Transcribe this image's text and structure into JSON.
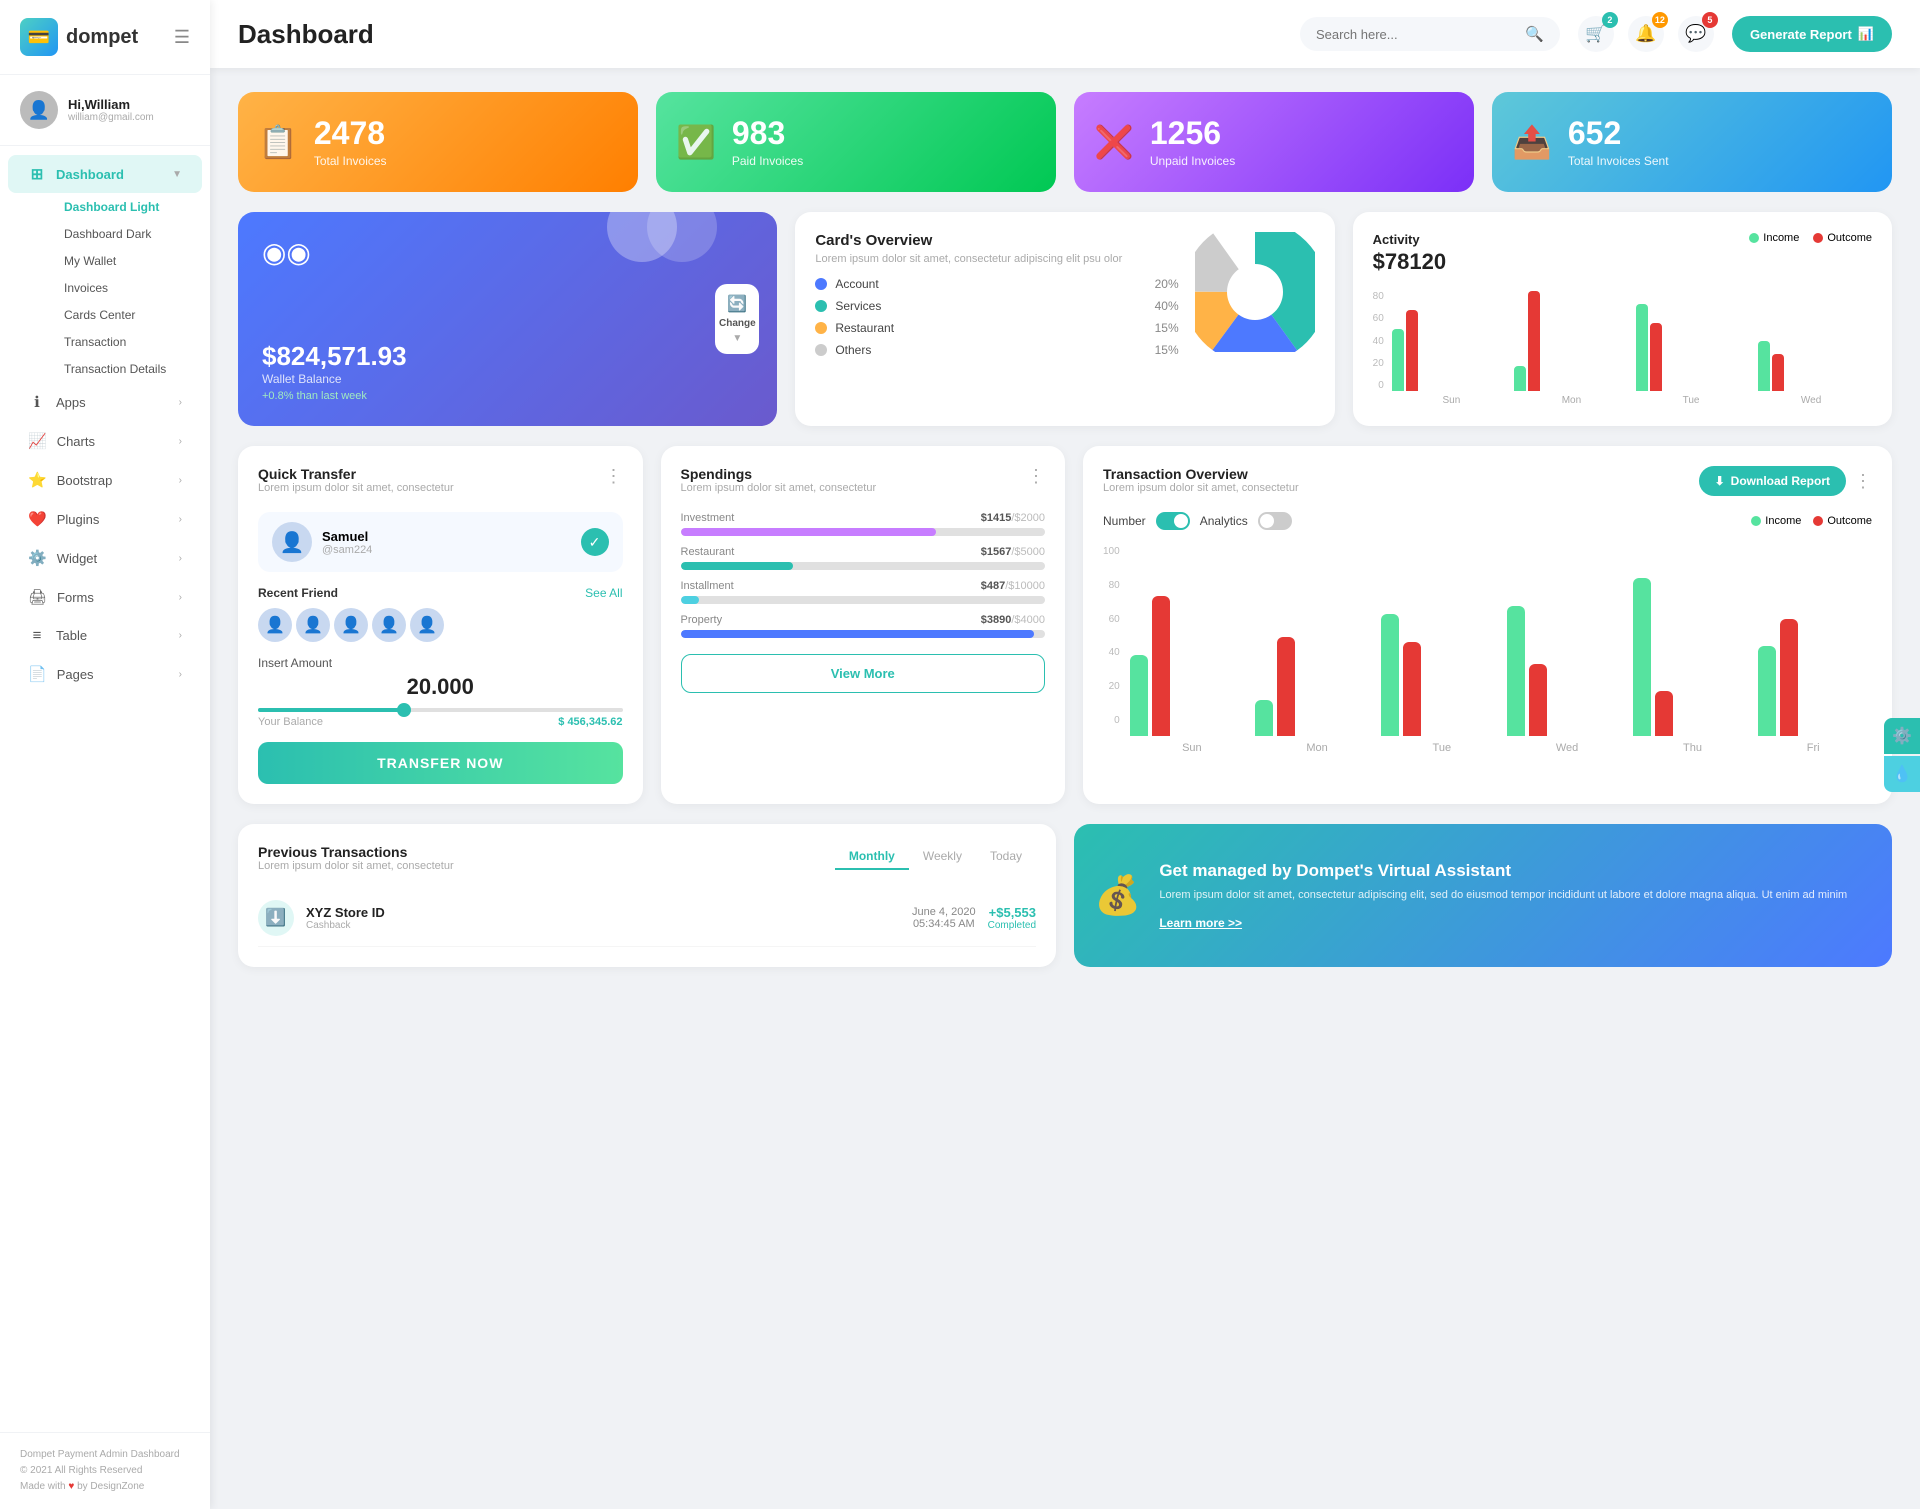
{
  "app": {
    "logo_text": "dompet",
    "logo_icon": "💳"
  },
  "user": {
    "greeting": "Hi,",
    "name": "William",
    "email": "william@gmail.com",
    "avatar_icon": "👤"
  },
  "header": {
    "title": "Dashboard",
    "search_placeholder": "Search here...",
    "generate_btn": "Generate Report",
    "badges": {
      "cart": "2",
      "bell": "12",
      "chat": "5"
    }
  },
  "stats": [
    {
      "number": "2478",
      "label": "Total Invoices",
      "icon": "📋",
      "color": "orange"
    },
    {
      "number": "983",
      "label": "Paid Invoices",
      "icon": "✅",
      "color": "green"
    },
    {
      "number": "1256",
      "label": "Unpaid Invoices",
      "icon": "❌",
      "color": "purple"
    },
    {
      "number": "652",
      "label": "Total Invoices Sent",
      "icon": "📤",
      "color": "teal"
    }
  ],
  "wallet": {
    "balance": "$824,571.93",
    "label": "Wallet Balance",
    "change": "+0.8% than last week",
    "change_btn": "Change"
  },
  "card_overview": {
    "title": "Card's Overview",
    "desc": "Lorem ipsum dolor sit amet, consectetur adipiscing elit psu olor",
    "legend": [
      {
        "label": "Account",
        "pct": "20%",
        "color": "#4d79ff"
      },
      {
        "label": "Services",
        "pct": "40%",
        "color": "#2bbfb0"
      },
      {
        "label": "Restaurant",
        "pct": "15%",
        "color": "#ffb347"
      },
      {
        "label": "Others",
        "pct": "15%",
        "color": "#ccc"
      }
    ]
  },
  "activity": {
    "title": "Activity",
    "amount": "$78120",
    "income_label": "Income",
    "outcome_label": "Outcome",
    "income_color": "#56e39f",
    "outcome_color": "#e53935",
    "bars": [
      {
        "day": "Sun",
        "income": 50,
        "outcome": 65
      },
      {
        "day": "Mon",
        "income": 20,
        "outcome": 80
      },
      {
        "day": "Tue",
        "income": 70,
        "outcome": 55
      },
      {
        "day": "Wed",
        "income": 40,
        "outcome": 30
      }
    ],
    "y_labels": [
      "80",
      "60",
      "40",
      "20",
      "0"
    ]
  },
  "quick_transfer": {
    "title": "Quick Transfer",
    "desc": "Lorem ipsum dolor sit amet, consectetur",
    "user_name": "Samuel",
    "user_handle": "@sam224",
    "recent_label": "Recent Friend",
    "see_all": "See All",
    "insert_label": "Insert Amount",
    "amount": "20.000",
    "balance_label": "Your Balance",
    "balance_value": "$ 456,345.62",
    "btn": "TRANSFER NOW"
  },
  "spendings": {
    "title": "Spendings",
    "desc": "Lorem ipsum dolor sit amet, consectetur",
    "items": [
      {
        "label": "Investment",
        "amount": "$1415",
        "max": "/$2000",
        "pct": 70,
        "color": "#c77dff"
      },
      {
        "label": "Restaurant",
        "amount": "$1567",
        "max": "/$5000",
        "pct": 31,
        "color": "#2bbfb0"
      },
      {
        "label": "Installment",
        "amount": "$487",
        "max": "/$10000",
        "pct": 5,
        "color": "#4dd0e1"
      },
      {
        "label": "Property",
        "amount": "$3890",
        "max": "/$4000",
        "pct": 97,
        "color": "#4d79ff"
      }
    ],
    "btn": "View More"
  },
  "transaction_overview": {
    "title": "Transaction Overview",
    "desc": "Lorem ipsum dolor sit amet, consectetur",
    "download_btn": "Download Report",
    "number_label": "Number",
    "analytics_label": "Analytics",
    "income_label": "Income",
    "outcome_label": "Outcome",
    "income_color": "#56e39f",
    "outcome_color": "#e53935",
    "bars": [
      {
        "day": "Sun",
        "income": 45,
        "outcome": 78
      },
      {
        "day": "Mon",
        "income": 20,
        "outcome": 55
      },
      {
        "day": "Tue",
        "income": 68,
        "outcome": 52
      },
      {
        "day": "Wed",
        "income": 72,
        "outcome": 40
      },
      {
        "day": "Thu",
        "income": 88,
        "outcome": 25
      },
      {
        "day": "Fri",
        "income": 50,
        "outcome": 65
      }
    ],
    "y_labels": [
      "100",
      "80",
      "60",
      "40",
      "20",
      "0"
    ]
  },
  "prev_transactions": {
    "title": "Previous Transactions",
    "desc": "Lorem ipsum dolor sit amet, consectetur",
    "tabs": [
      "Monthly",
      "Weekly",
      "Today"
    ],
    "active_tab": "Monthly",
    "rows": [
      {
        "icon": "⬇️",
        "name": "XYZ Store ID",
        "sub": "Cashback",
        "date": "June 4, 2020",
        "time": "05:34:45 AM",
        "amount": "+$5,553",
        "status": "Completed",
        "icon_bg": "#e0f7f5"
      }
    ]
  },
  "virtual_assistant": {
    "title": "Get managed by Dompet's Virtual Assistant",
    "desc": "Lorem ipsum dolor sit amet, consectetur adipiscing elit, sed do eiusmod tempor incididunt ut labore et dolore magna aliqua. Ut enim ad minim",
    "link": "Learn more >>",
    "icon": "💰"
  },
  "sidebar": {
    "nav": [
      {
        "id": "dashboard",
        "label": "Dashboard",
        "icon": "⊞",
        "has_arrow": true,
        "active": true
      },
      {
        "id": "apps",
        "label": "Apps",
        "icon": "ℹ",
        "has_arrow": true
      },
      {
        "id": "charts",
        "label": "Charts",
        "icon": "📈",
        "has_arrow": true
      },
      {
        "id": "bootstrap",
        "label": "Bootstrap",
        "icon": "⭐",
        "has_arrow": true
      },
      {
        "id": "plugins",
        "label": "Plugins",
        "icon": "❤️",
        "has_arrow": true
      },
      {
        "id": "widget",
        "label": "Widget",
        "icon": "⚙️",
        "has_arrow": true
      },
      {
        "id": "forms",
        "label": "Forms",
        "icon": "🖨",
        "has_arrow": true
      },
      {
        "id": "table",
        "label": "Table",
        "icon": "≡",
        "has_arrow": true
      },
      {
        "id": "pages",
        "label": "Pages",
        "icon": "📄",
        "has_arrow": true
      }
    ],
    "submenu": [
      "Dashboard Light",
      "Dashboard Dark",
      "My Wallet",
      "Invoices",
      "Cards Center",
      "Transaction",
      "Transaction Details"
    ],
    "footer": {
      "line1": "Dompet Payment Admin Dashboard",
      "line2": "© 2021 All Rights Reserved",
      "line3": "Made with ♥ by DesignZone"
    }
  }
}
